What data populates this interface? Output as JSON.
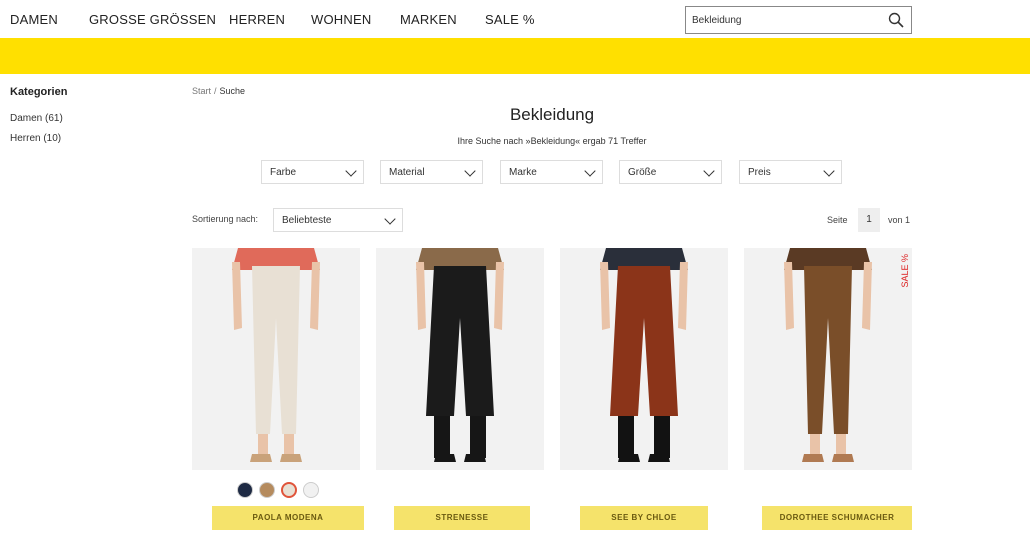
{
  "nav": {
    "items": [
      "DAMEN",
      "GROSSE GRÖSSEN",
      "HERREN",
      "WOHNEN",
      "MARKEN",
      "SALE %"
    ],
    "search_value": "Bekleidung"
  },
  "sidebar": {
    "heading": "Kategorien",
    "items": [
      "Damen (61)",
      "Herren (10)"
    ]
  },
  "breadcrumb": {
    "home": "Start",
    "separator": "/",
    "current": "Suche"
  },
  "main": {
    "title": "Bekleidung",
    "result_text": "Ihre Suche nach »Bekleidung« ergab 71 Treffer"
  },
  "filters": [
    "Farbe",
    "Material",
    "Marke",
    "Größe",
    "Preis"
  ],
  "sort": {
    "label": "Sortierung nach:",
    "value": "Beliebteste"
  },
  "pager": {
    "label": "Seite",
    "current": "1",
    "of_label": "von 1"
  },
  "products": [
    {
      "brand": "PAOLA MODENA",
      "image": "trousers-cream",
      "pants_color": "#e8e0d4",
      "top_color": "#e06a5a",
      "shoe_color": "#c9a27a",
      "sale_badge": "",
      "swatches": [
        {
          "color": "#1e2a44"
        },
        {
          "color": "#b58b5e"
        },
        {
          "color": "#e8e0d4",
          "selected": true
        },
        {
          "color": "#f1f1f1"
        }
      ]
    },
    {
      "brand": "STRENESSE",
      "image": "culottes-black",
      "pants_color": "#1b1b1b",
      "top_color": "#8a6a4a",
      "shoe_color": "#161616",
      "sale_badge": "",
      "swatches": []
    },
    {
      "brand": "SEE BY CHLOE",
      "image": "culottes-rust",
      "pants_color": "#8b3419",
      "top_color": "#2a2f3a",
      "shoe_color": "#121212",
      "sale_badge": "",
      "swatches": []
    },
    {
      "brand": "DOROTHEE SCHUMACHER",
      "image": "trousers-brown",
      "pants_color": "#7a4e29",
      "top_color": "#5a3a24",
      "shoe_color": "#b07a52",
      "sale_badge": "SALE %",
      "swatches": []
    }
  ]
}
